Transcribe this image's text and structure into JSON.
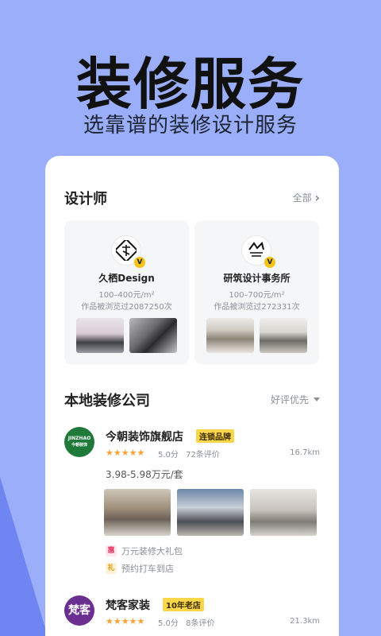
{
  "hero": {
    "title": "装修服务",
    "subtitle": "选靠谱的装修设计服务"
  },
  "designers_section": {
    "title": "设计师",
    "more_label": "全部",
    "designers": [
      {
        "name": "久栖Design",
        "price": "100–400元/m²",
        "views": "作品被浏览过2087250次",
        "badge": "V"
      },
      {
        "name": "研筑设计事务所",
        "price": "100–700元/m²",
        "views": "作品被浏览过272331次",
        "badge": "V"
      }
    ]
  },
  "companies_section": {
    "title": "本地装修公司",
    "sort_label": "好评优先",
    "companies": [
      {
        "name": "今朝装饰旗舰店",
        "tag": "连锁品牌",
        "logo_text": "JINZHAO",
        "logo_sub": "今朝装饰",
        "stars": "★★★★★",
        "rating": "5.0分",
        "reviews": "72条评价",
        "distance": "16.7km",
        "price": "3.98-5.98万元/套",
        "perks": [
          {
            "icon": "惠",
            "text": "万元装修大礼包"
          },
          {
            "icon": "礼",
            "text": "预约打车到店"
          }
        ]
      },
      {
        "name": "梵客家装",
        "tag": "10年老店",
        "logo_text": "梵客",
        "stars": "★★★★★",
        "rating": "5.0分",
        "reviews": "8条评价",
        "distance": "21.3km"
      }
    ]
  },
  "colors": {
    "background": "#9aaef9",
    "star": "#f7a23a",
    "tag": "#f9d64a",
    "jinzhao_logo": "#1f7a3a",
    "fanke_logo": "#6a2f8f"
  }
}
